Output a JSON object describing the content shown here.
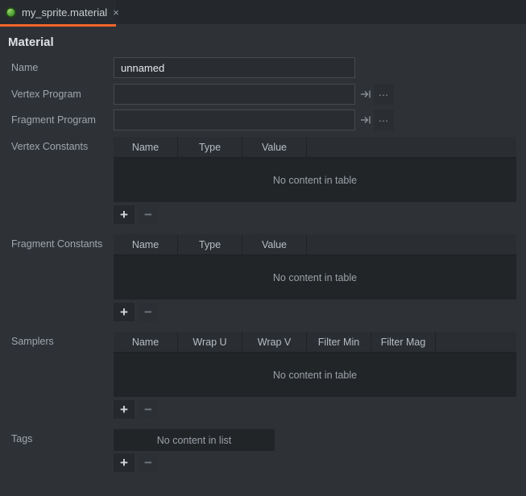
{
  "tab": {
    "title": "my_sprite.material",
    "close_glyph": "×",
    "icon": "material-sphere-icon"
  },
  "heading": "Material",
  "fields": {
    "name": {
      "label": "Name",
      "value": "unnamed"
    },
    "vertex_program": {
      "label": "Vertex Program",
      "value": "",
      "browse_glyph": "…"
    },
    "fragment_program": {
      "label": "Fragment Program",
      "value": "",
      "browse_glyph": "…"
    }
  },
  "vertex_constants": {
    "label": "Vertex Constants",
    "columns": [
      "Name",
      "Type",
      "Value"
    ],
    "empty_text": "No content in table",
    "add_glyph": "+",
    "remove_glyph": "−"
  },
  "fragment_constants": {
    "label": "Fragment Constants",
    "columns": [
      "Name",
      "Type",
      "Value"
    ],
    "empty_text": "No content in table",
    "add_glyph": "+",
    "remove_glyph": "−"
  },
  "samplers": {
    "label": "Samplers",
    "columns": [
      "Name",
      "Wrap U",
      "Wrap V",
      "Filter Min",
      "Filter Mag"
    ],
    "empty_text": "No content in table",
    "add_glyph": "+",
    "remove_glyph": "−"
  },
  "tags": {
    "label": "Tags",
    "empty_text": "No content in list",
    "add_glyph": "+",
    "remove_glyph": "−"
  },
  "colors": {
    "accent_orange": "#f4662a",
    "tab_bar_bg": "#24282c",
    "page_bg": "#2e3237",
    "table_body_bg": "#222528",
    "input_border": "#46494d",
    "icon_green": "#55a63c"
  }
}
